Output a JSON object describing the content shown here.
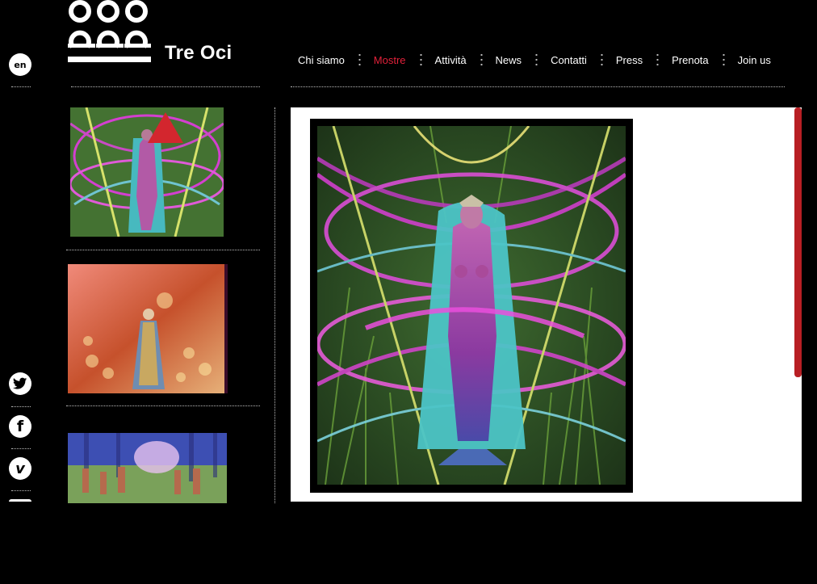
{
  "brand": {
    "name": "Tre Oci"
  },
  "language": {
    "label": "en"
  },
  "nav": {
    "items": [
      {
        "label": "Chi siamo",
        "active": false
      },
      {
        "label": "Mostre",
        "active": true
      },
      {
        "label": "Attività",
        "active": false
      },
      {
        "label": "News",
        "active": false
      },
      {
        "label": "Contatti",
        "active": false
      },
      {
        "label": "Press",
        "active": false
      },
      {
        "label": "Prenota",
        "active": false
      },
      {
        "label": "Join us",
        "active": false
      }
    ]
  },
  "social": {
    "twitter_icon": "twitter-icon",
    "facebook_icon": "facebook-icon",
    "vimeo_icon": "vimeo-icon",
    "facebook_glyph": "f",
    "vimeo_glyph": "v"
  },
  "colors": {
    "accent": "#e2213a",
    "scrollbar": "#b81f24",
    "background": "#000000",
    "panel": "#ffffff"
  }
}
